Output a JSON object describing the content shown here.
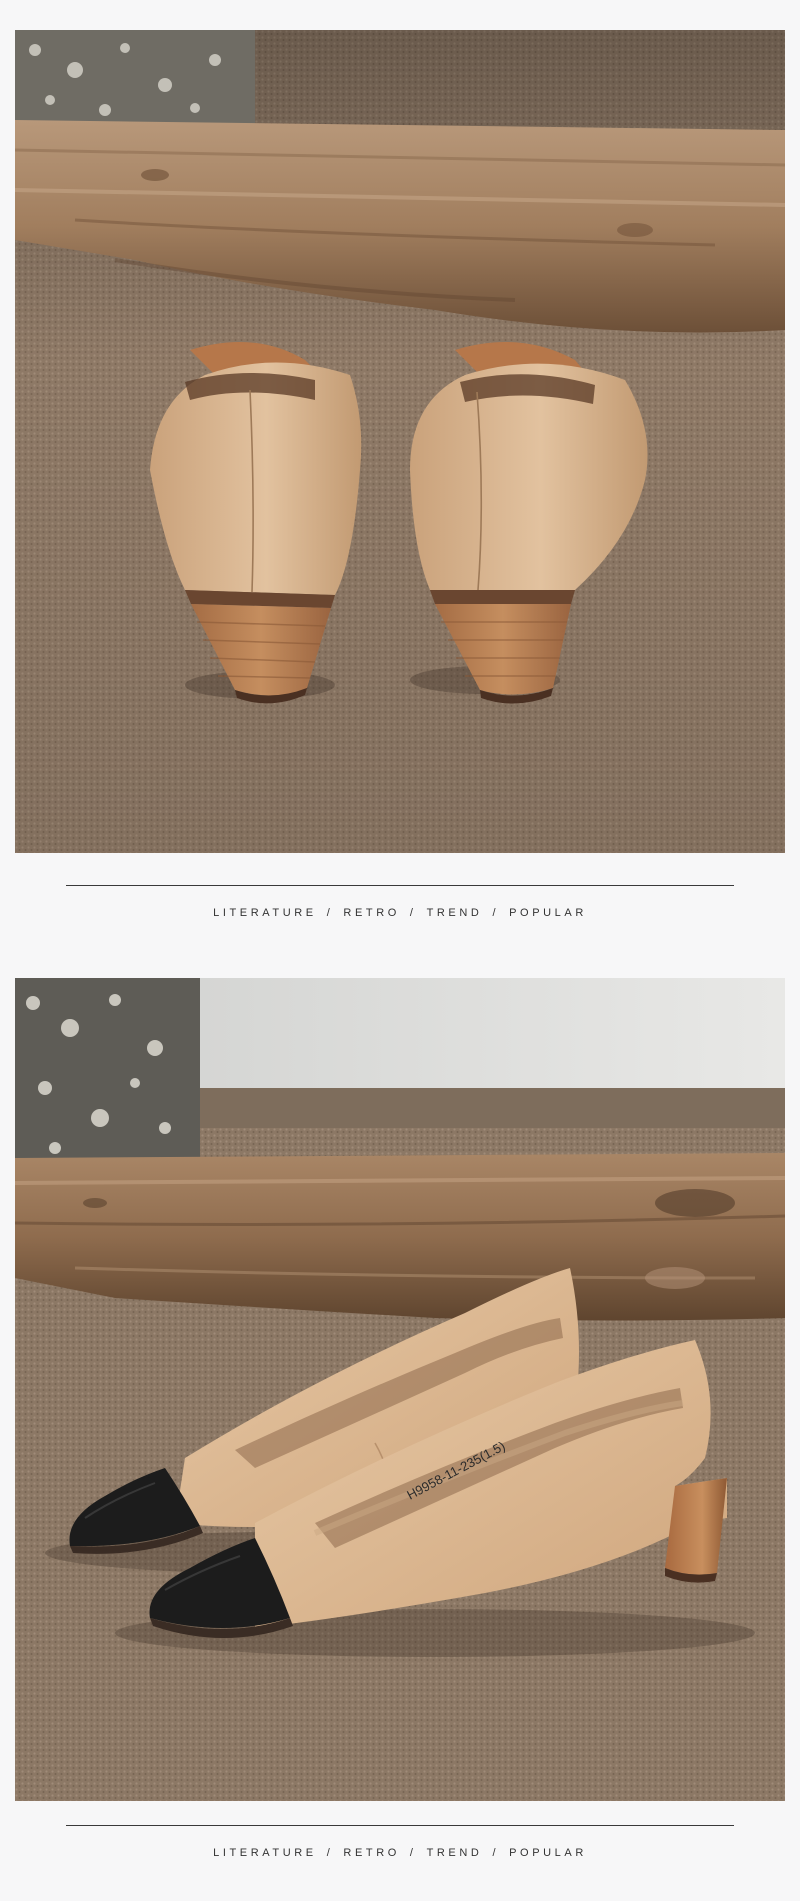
{
  "banner_1": {
    "tags": [
      "LITERATURE",
      "RETRO",
      "TREND",
      "POPULAR"
    ],
    "separator": "/"
  },
  "banner_2": {
    "tags": [
      "LITERATURE",
      "RETRO",
      "TREND",
      "POPULAR"
    ],
    "separator": "/"
  },
  "photo_2": {
    "insole_code": "H9958-11-235(1.5)"
  },
  "colors": {
    "page_background": "#f7f7f8",
    "carpet": "#8f7a66",
    "nude_leather": "#d9b48e",
    "wood_heel": "#b07a4e",
    "black_cap": "#1b1b1b",
    "divider_line": "#3a3a3a"
  }
}
